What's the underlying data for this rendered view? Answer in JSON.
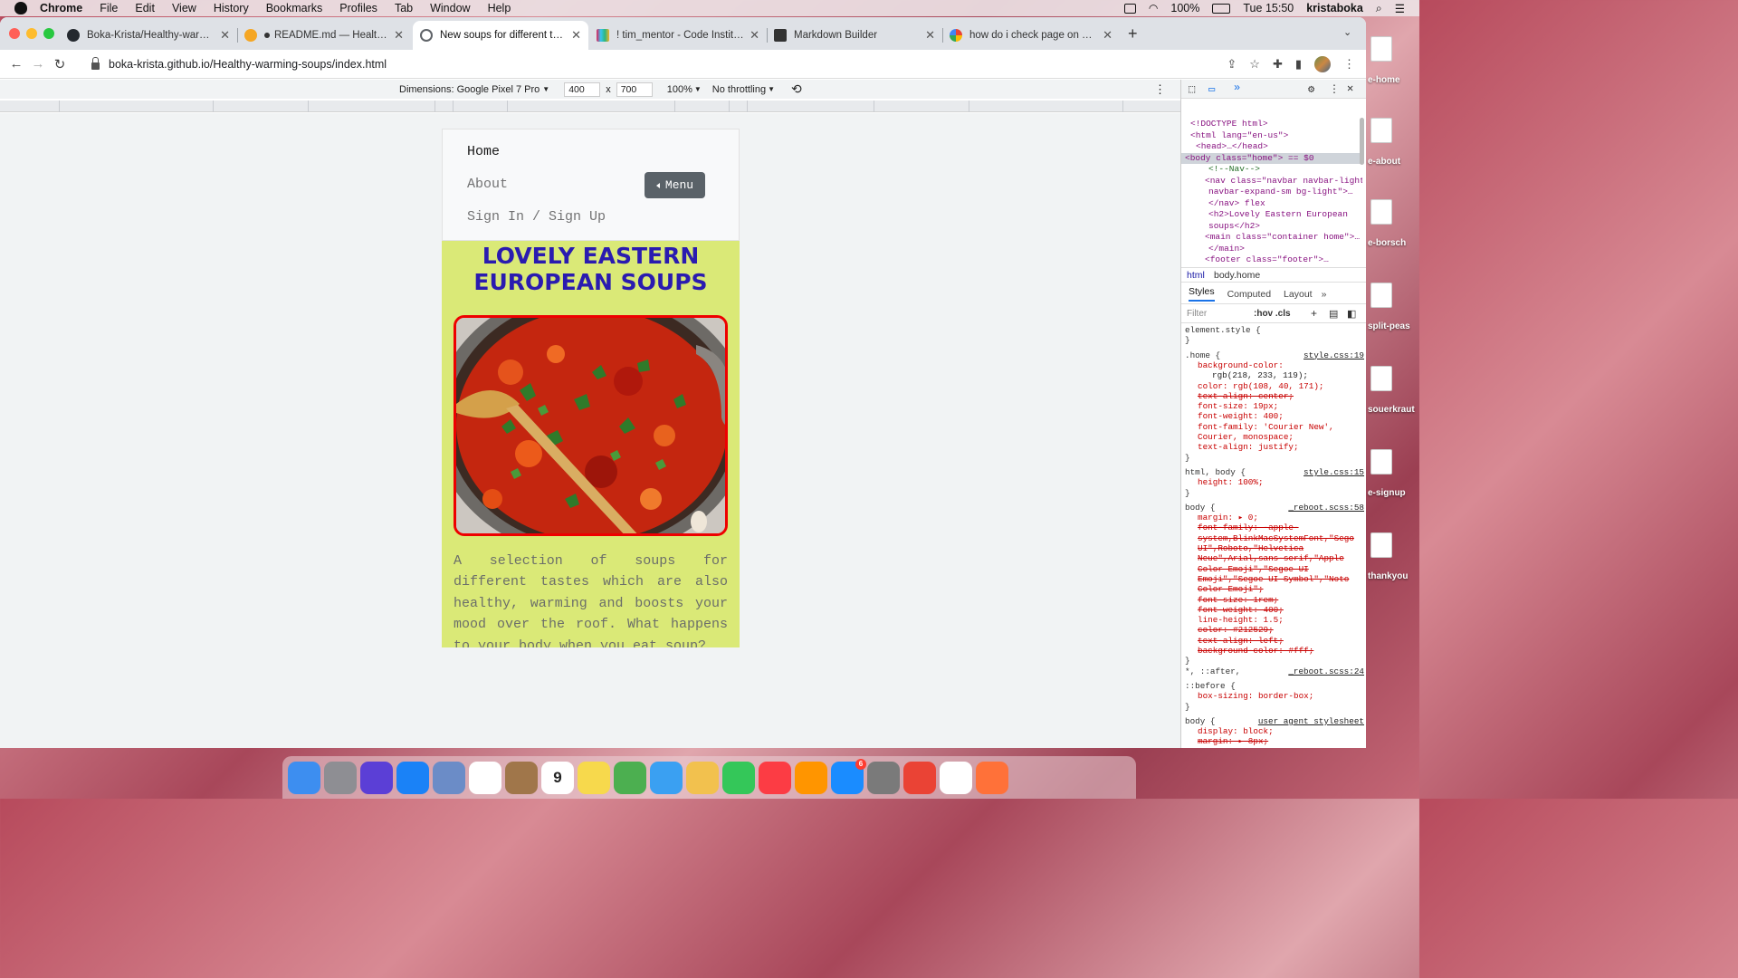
{
  "menubar": {
    "app_name": "Chrome",
    "items": [
      "File",
      "Edit",
      "View",
      "History",
      "Bookmarks",
      "Profiles",
      "Tab",
      "Window",
      "Help"
    ],
    "battery": "100%",
    "clock": "Tue 15:50",
    "user": "kristaboka"
  },
  "tabs": [
    {
      "title": "Boka-Krista/Healthy-warming-",
      "color": "#24292f"
    },
    {
      "title": "README.md — Healthy-war",
      "color": "#f5a623"
    },
    {
      "title": "New soups for different tastes",
      "color": "#5f6368"
    },
    {
      "title": "! tim_mentor - Code Institute -",
      "color": "#e01e5a"
    },
    {
      "title": "Markdown Builder",
      "color": "#333333"
    },
    {
      "title": "how do i check page on excel a",
      "color": "#4285f4"
    }
  ],
  "address": {
    "url": "boka-krista.github.io/Healthy-warming-soups/index.html"
  },
  "device_toolbar": {
    "dimensions_label": "Dimensions: Google Pixel 7 Pro",
    "width": "400",
    "height": "700",
    "separator": "x",
    "zoom": "100%",
    "throttling": "No throttling"
  },
  "site": {
    "nav": {
      "home": "Home",
      "about": "About",
      "signin": "Sign In / Sign Up",
      "menu_button": "Menu"
    },
    "heading": "LOVELY EASTERN EUROPEAN SOUPS",
    "intro": "A selection of soups for different tastes which are also healthy, warming and boosts your mood over the roof. What happens to your body when you eat soup?",
    "colors": {
      "background": "#dae977",
      "heading": "#2a1bb0",
      "image_border": "#e00000"
    }
  },
  "devtools": {
    "dom": [
      "<!DOCTYPE html>",
      "<html lang=\"en-us\">",
      "<head>…</head>",
      "<body class=\"home\"> == $0",
      "<!--Nav-->",
      "<nav class=\"navbar navbar-light",
      "navbar-expand-sm bg-light\">…",
      "</nav> flex",
      "<h2>Lovely Eastern European",
      "soups</h2>",
      "<main class=\"container home\">…",
      "</main>",
      "<footer class=\"footer\">…"
    ],
    "breadcrumbs": [
      "html",
      "body.home"
    ],
    "style_tabs": [
      "Styles",
      "Computed",
      "Layout",
      "»"
    ],
    "filter_placeholder": "Filter",
    "filter_tools": ":hov  .cls",
    "rules": [
      {
        "text": "element.style {",
        "cls": ""
      },
      {
        "text": "}",
        "cls": ""
      },
      {
        "text": ".home {",
        "cls": "",
        "src": "style.css:19"
      },
      {
        "text": "background-color:",
        "cls": "prop"
      },
      {
        "text": "rgb(218, 233, 119);",
        "cls": "prop"
      },
      {
        "text": "color: rgb(108, 40, 171);",
        "cls": "prop"
      },
      {
        "text": "text-align: center;",
        "cls": "strike"
      },
      {
        "text": "font-size: 19px;",
        "cls": "prop"
      },
      {
        "text": "font-weight: 400;",
        "cls": "prop"
      },
      {
        "text": "font-family: 'Courier New',",
        "cls": "prop"
      },
      {
        "text": "Courier, monospace;",
        "cls": "prop"
      },
      {
        "text": "text-align: justify;",
        "cls": "prop"
      },
      {
        "text": "}",
        "cls": ""
      },
      {
        "text": "html, body {",
        "cls": "",
        "src": "style.css:15"
      },
      {
        "text": "height: 100%;",
        "cls": "prop"
      },
      {
        "text": "}",
        "cls": ""
      },
      {
        "text": "body {",
        "cls": "",
        "src": "_reboot.scss:58"
      },
      {
        "text": "margin: ▸ 0;",
        "cls": "prop"
      },
      {
        "text": "font-family: -apple-",
        "cls": "strike"
      },
      {
        "text": "system,BlinkMacSystemFont,\"Sego",
        "cls": "strike"
      },
      {
        "text": "UI\",Roboto,\"Helvetica",
        "cls": "strike"
      },
      {
        "text": "Neue\",Arial,sans-serif,\"Apple",
        "cls": "strike"
      },
      {
        "text": "Color Emoji\",\"Segoe UI",
        "cls": "strike"
      },
      {
        "text": "Emoji\",\"Segoe UI Symbol\",\"Noto",
        "cls": "strike"
      },
      {
        "text": "Color Emoji\";",
        "cls": "strike"
      },
      {
        "text": "font-size: 1rem;",
        "cls": "strike"
      },
      {
        "text": "font-weight: 400;",
        "cls": "strike"
      },
      {
        "text": "line-height: 1.5;",
        "cls": "prop"
      },
      {
        "text": "color: #212529;",
        "cls": "strike"
      },
      {
        "text": "text-align: left;",
        "cls": "strike"
      },
      {
        "text": "background-color: #fff;",
        "cls": "strike"
      },
      {
        "text": "}",
        "cls": ""
      },
      {
        "text": "*, ::after,",
        "cls": "",
        "src": "_reboot.scss:24"
      },
      {
        "text": "::before {",
        "cls": ""
      },
      {
        "text": "box-sizing: border-box;",
        "cls": "prop"
      },
      {
        "text": "}",
        "cls": ""
      },
      {
        "text": "body {",
        "cls": "",
        "src": "user agent stylesheet"
      },
      {
        "text": "display: block;",
        "cls": "prop"
      },
      {
        "text": "margin: ▸ 8px;",
        "cls": "strike"
      },
      {
        "text": "}",
        "cls": ""
      }
    ]
  },
  "desktop_labels": [
    "e-home",
    "e-about",
    "e-borsch",
    "split-peas",
    "souerkraut",
    "e-signup",
    "thankyou"
  ],
  "dock_apps": [
    "finder-icon",
    "launchpad-icon",
    "siri-icon",
    "safari-icon",
    "mail-icon",
    "reminders-icon",
    "notes-book-icon",
    "calendar-icon",
    "stickies-icon",
    "maps-icon",
    "messages-icon",
    "photos-icon",
    "facetime-icon",
    "music-icon",
    "books-icon",
    "app-store-icon",
    "system-preferences-icon",
    "chrome-icon",
    "vscode-icon",
    "firefox-icon"
  ],
  "calendar_day": "9",
  "app_store_badge": "6"
}
